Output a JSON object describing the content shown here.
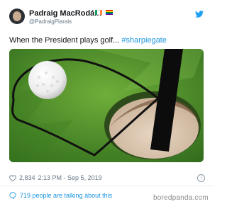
{
  "author": {
    "name": "Padraig MacRodáin",
    "handle": "@PadraigPiarais"
  },
  "tweet": {
    "text_plain": "When the President plays golf...",
    "hashtag": "#sharpiegate"
  },
  "stats": {
    "likes": "2,834",
    "time": "2:13 PM - Sep 5, 2019"
  },
  "footer": {
    "talking": "719 people are talking about this"
  },
  "watermark": "boredpanda.com",
  "colors": {
    "link": "#1b95e0",
    "muted": "#657786"
  },
  "icons": {
    "twitter": "twitter-bird-icon",
    "heart": "heart-icon",
    "info": "info-icon",
    "comment": "comment-bubble-icon"
  }
}
